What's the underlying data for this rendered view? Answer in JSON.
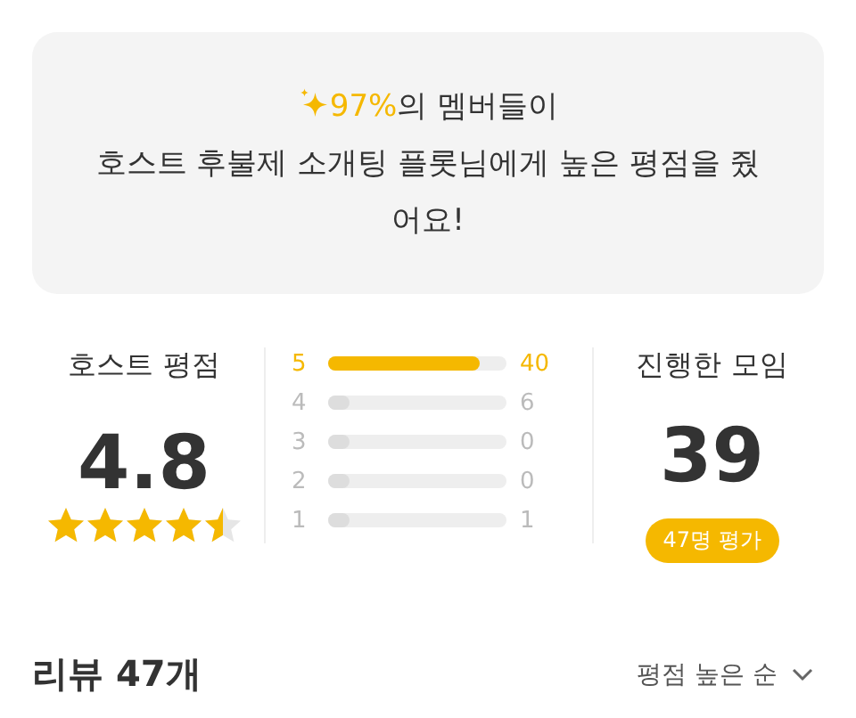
{
  "banner": {
    "percent": "97%",
    "line1_rest": "의 멤버들이",
    "line2": "호스트 후불제 소개팅 플롯님에게 높은 평점을 줬어요!"
  },
  "host_rating": {
    "label": "호스트 평점",
    "score": "4.8",
    "stars": 4.5
  },
  "distribution": [
    {
      "score": "5",
      "count": "40",
      "level": 0.85,
      "highlighted": true
    },
    {
      "score": "4",
      "count": "6",
      "level": 0.12,
      "highlighted": false
    },
    {
      "score": "3",
      "count": "0",
      "level": 0.12,
      "highlighted": false
    },
    {
      "score": "2",
      "count": "0",
      "level": 0.12,
      "highlighted": false
    },
    {
      "score": "1",
      "count": "1",
      "level": 0.12,
      "highlighted": false
    }
  ],
  "meetings": {
    "label": "진행한 모임",
    "count": "39",
    "badge": "47명 평가"
  },
  "reviews": {
    "title": "리뷰 47개",
    "sort": "평점 높은 순"
  }
}
